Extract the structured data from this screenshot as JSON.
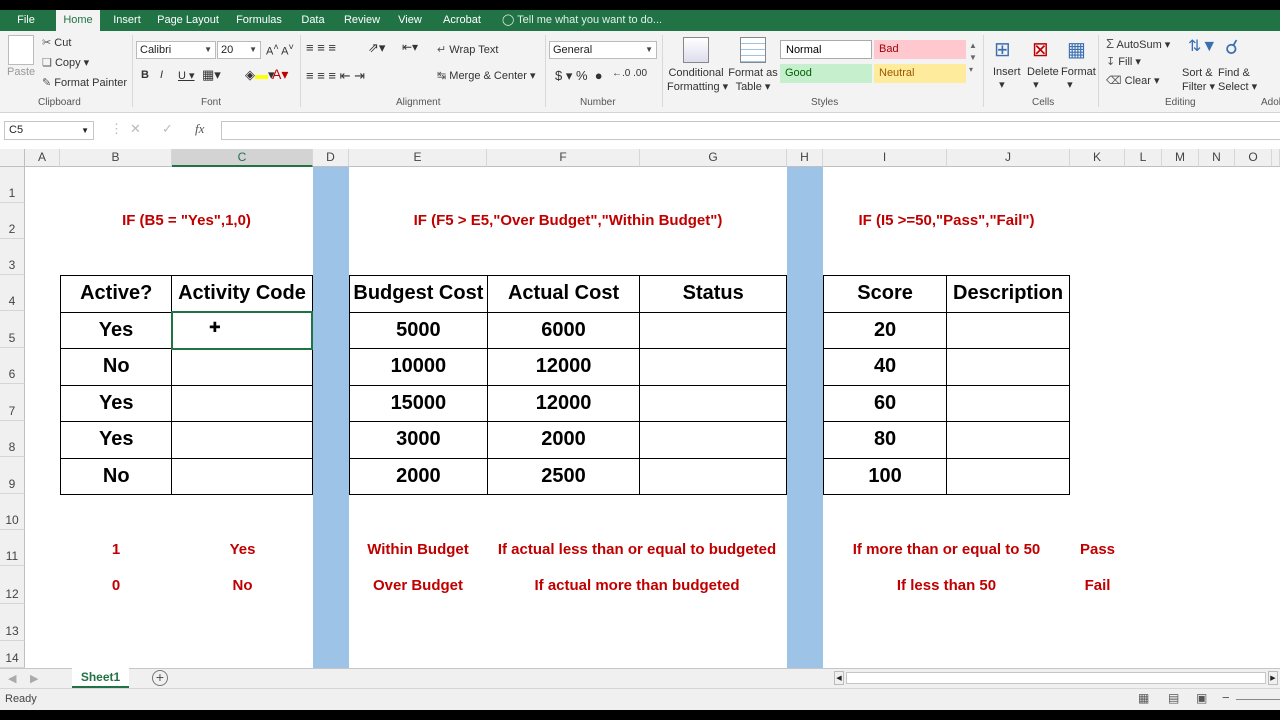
{
  "ribbon_tabs": [
    "File",
    "Home",
    "Insert",
    "Page Layout",
    "Formulas",
    "Data",
    "Review",
    "View",
    "Acrobat"
  ],
  "tell_me": "Tell me what you want to do...",
  "clipboard": {
    "paste": "Paste",
    "cut": "Cut",
    "copy": "Copy",
    "format_painter": "Format Painter",
    "group": "Clipboard"
  },
  "font": {
    "name": "Calibri",
    "size": "20",
    "group": "Font"
  },
  "alignment": {
    "wrap": "Wrap Text",
    "merge": "Merge & Center",
    "group": "Alignment"
  },
  "number": {
    "format": "General",
    "group": "Number"
  },
  "styles": {
    "conditional": "Conditional",
    "formatting": "Formatting",
    "format_as": "Format as",
    "table": "Table",
    "normal": "Normal",
    "bad": "Bad",
    "good": "Good",
    "neutral": "Neutral",
    "group": "Styles"
  },
  "cells": {
    "insert": "Insert",
    "delete": "Delete",
    "format": "Format",
    "group": "Cells"
  },
  "editing": {
    "autosum": "AutoSum",
    "fill": "Fill",
    "clear": "Clear",
    "sort": "Sort &",
    "filter": "Filter",
    "find": "Find &",
    "select": "Select",
    "group": "Editing",
    "adobe": "Adol"
  },
  "name_box": "C5",
  "columns": [
    "A",
    "B",
    "C",
    "D",
    "E",
    "F",
    "G",
    "H",
    "I",
    "J",
    "K",
    "L",
    "M",
    "N",
    "O"
  ],
  "rows": [
    "1",
    "2",
    "3",
    "4",
    "5",
    "6",
    "7",
    "8",
    "9",
    "10",
    "11",
    "12",
    "13",
    "14"
  ],
  "formulas": {
    "f1": "IF (B5 = \"Yes\",1,0)",
    "f2": "IF (F5 > E5,\"Over Budget\",\"Within Budget\")",
    "f3": "IF (I5 >=50,\"Pass\",\"Fail\")"
  },
  "table1": {
    "headers": [
      "Active?",
      "Activity Code"
    ],
    "rows": [
      [
        "Yes",
        ""
      ],
      [
        "No",
        ""
      ],
      [
        "Yes",
        ""
      ],
      [
        "Yes",
        ""
      ],
      [
        "No",
        ""
      ]
    ]
  },
  "table2": {
    "headers": [
      "Budgest Cost",
      "Actual Cost",
      "Status"
    ],
    "rows": [
      [
        "5000",
        "6000",
        ""
      ],
      [
        "10000",
        "12000",
        ""
      ],
      [
        "15000",
        "12000",
        ""
      ],
      [
        "3000",
        "2000",
        ""
      ],
      [
        "2000",
        "2500",
        ""
      ]
    ]
  },
  "table3": {
    "headers": [
      "Score",
      "Description"
    ],
    "rows": [
      [
        "20",
        ""
      ],
      [
        "40",
        ""
      ],
      [
        "60",
        ""
      ],
      [
        "80",
        ""
      ],
      [
        "100",
        ""
      ]
    ]
  },
  "notes": {
    "b11": "1",
    "c11": "Yes",
    "b12": "0",
    "c12": "No",
    "e11": "Within Budget",
    "f11": "If actual less than or equal to budgeted",
    "e12": "Over Budget",
    "f12": "If actual more than budgeted",
    "i11": "If more than or equal to 50",
    "k11": "Pass",
    "i12": "If less than 50",
    "k12": "Fail"
  },
  "sheet_tab": "Sheet1",
  "status": "Ready",
  "colors": {
    "excel_green": "#217346",
    "band": "#9dc3e6",
    "red_text": "#c00000"
  }
}
